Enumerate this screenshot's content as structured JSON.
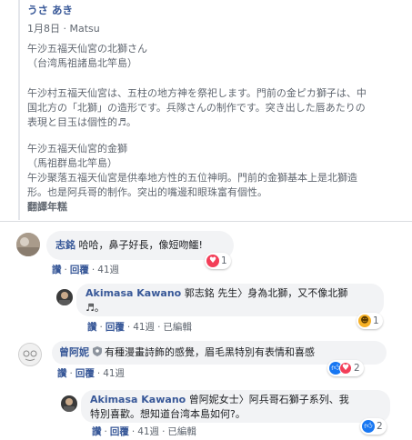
{
  "post": {
    "author": "うさ あき",
    "date": "1月8日",
    "separator": "·",
    "location": "Matsu",
    "p1_line1": "午沙五福天仙宮の北獅さん",
    "p1_line2": "（台湾馬祖諸島北竿島）",
    "p2_line1": "午沙村五福天仙宮は、五柱の地方神を祭祀します。門前の金ピカ獅子は、中",
    "p2_line2": "国北方の「北獅」の造形です。兵隊さんの制作です。突き出した唇あたりの",
    "p2_line3": "表現と目玉は個性的♬。",
    "p3_line1": "午沙五福天仙宮的金獅",
    "p3_line2": "（馬祖群島北竿島）",
    "p3_line3": "午沙聚落五福天仙宮是供奉地方性的五位神明。門前的金獅基本上是北獅造",
    "p3_line4": "形。也是阿兵哥的制作。突出的嘴邊和眼珠富有個性。",
    "translate": "翻譯年糕"
  },
  "comments": [
    {
      "name": "志銘",
      "text": "哈哈，鼻子好長，像短吻鱷!",
      "like": "讚",
      "reply": "回覆",
      "time": "41週",
      "reaction_count": "1",
      "reaction_icon": "heart-icon"
    },
    {
      "name": "Akimasa Kawano",
      "line1": "郭志銘 先生〉身為北獅，又不像北獅",
      "line2": "♬。",
      "like": "讚",
      "reply": "回覆",
      "time": "41週",
      "edited": "已編輯",
      "reaction_count": "1",
      "reaction_icon": "haha-icon"
    },
    {
      "name": "曾阿妮",
      "badge_icon": "shield-icon",
      "text": "有種漫畫詩飾的感覺，眉毛黑特別有表情和喜感",
      "like": "讚",
      "reply": "回覆",
      "time": "41週",
      "reaction_count": "2",
      "reaction_icons": [
        "like-icon",
        "heart-icon"
      ]
    },
    {
      "name": "Akimasa Kawano",
      "line1": "曾阿妮女士〉阿兵哥石獅子系列、我",
      "line2": "特別喜歡。想知道台湾本島如何?。",
      "like": "讚",
      "reply": "回覆",
      "time": "41週",
      "edited": "已編輯",
      "reaction_count": "2",
      "reaction_icon": "like-icon"
    }
  ],
  "colors": {
    "link": "#385898",
    "meta": "#606770",
    "bubble": "#f2f3f5",
    "like": "#1877f2",
    "heart": "#f33e58",
    "haha": "#f7b125"
  }
}
